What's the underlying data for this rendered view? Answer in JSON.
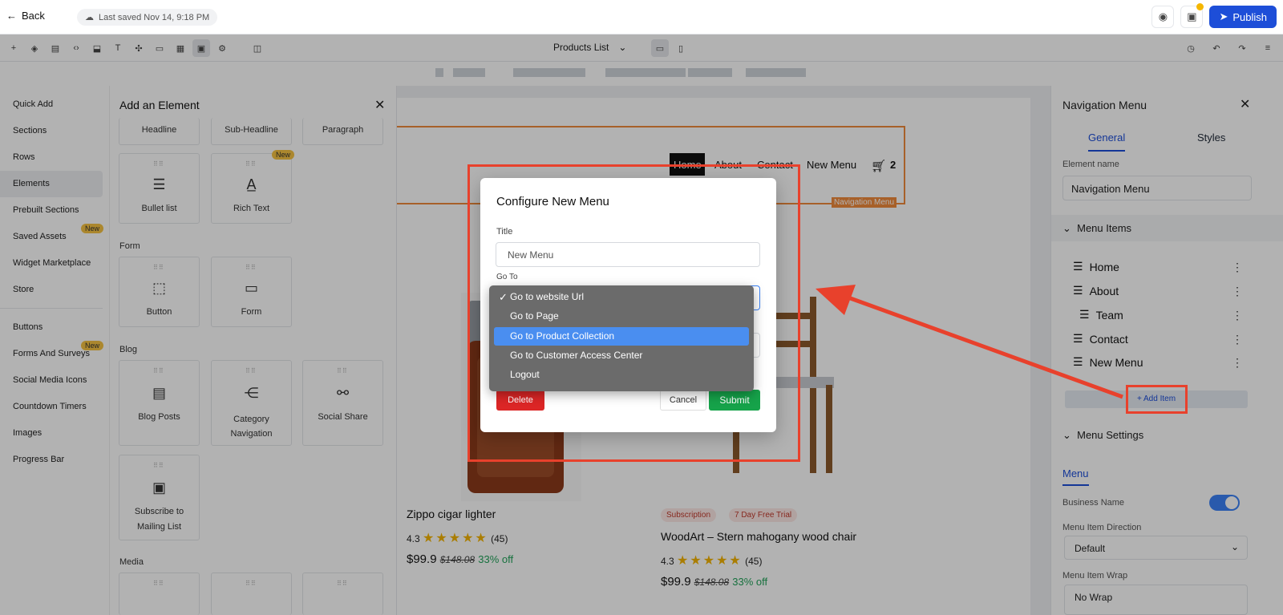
{
  "topbar": {
    "back_label": "Back",
    "saved_label": "Last saved Nov 14, 9:18 PM",
    "publish_label": "Publish"
  },
  "toolbar": {
    "page_select": "Products List"
  },
  "leftnav": {
    "items": [
      "Quick Add",
      "Sections",
      "Rows",
      "Elements",
      "Prebuilt Sections",
      "Saved Assets",
      "Widget Marketplace",
      "Store",
      "Buttons",
      "Forms And Surveys",
      "Social Media Icons",
      "Countdown Timers",
      "Images",
      "Progress Bar"
    ],
    "new_badge": "New"
  },
  "element_panel": {
    "title": "Add an Element",
    "top_cards": [
      "Headline",
      "Sub-Headline",
      "Paragraph"
    ],
    "cards_row1": [
      "Bullet list",
      "Rich Text"
    ],
    "form_label": "Form",
    "form_cards": [
      "Button",
      "Form"
    ],
    "blog_label": "Blog",
    "blog_cards": [
      "Blog Posts",
      "Category Navigation",
      "Social Share"
    ],
    "subscribe_card": "Subscribe to Mailing List",
    "media_label": "Media"
  },
  "canvas": {
    "menu": [
      "Home",
      "About",
      "Contact",
      "New Menu"
    ],
    "cart_count": "2",
    "nav_tag": "Navigation Menu",
    "products": [
      {
        "title": "Zippo cigar lighter",
        "rating": "4.3",
        "reviews": "(45)",
        "price": "$99.9",
        "old_price": "$148.08",
        "off": "33% off"
      },
      {
        "title": "WoodArt – Stern mahogany wood chair",
        "rating": "4.3",
        "reviews": "(45)",
        "price": "$99.9",
        "old_price": "$148.08",
        "off": "33% off",
        "tags": [
          "Subscription",
          "7 Day Free Trial"
        ]
      }
    ]
  },
  "modal": {
    "title": "Configure New Menu",
    "title_label": "Title",
    "title_placeholder": "New Menu",
    "goto_label": "Go To",
    "delete_label": "Delete",
    "cancel_label": "Cancel",
    "submit_label": "Submit",
    "options": [
      "Go to website Url",
      "Go to Page",
      "Go to Product Collection",
      "Go to Customer Access Center",
      "Logout"
    ],
    "selected_option": "Go to website Url",
    "highlighted_option": "Go to Product Collection"
  },
  "rightpanel": {
    "title": "Navigation Menu",
    "tabs": [
      "General",
      "Styles"
    ],
    "element_name_label": "Element name",
    "element_name_value": "Navigation Menu",
    "menu_items_label": "Menu Items",
    "menu_items": [
      "Home",
      "About",
      "Team",
      "Contact",
      "New Menu"
    ],
    "add_item_label": "Add Item",
    "menu_settings_label": "Menu Settings",
    "menu_subtab": "Menu",
    "business_name_label": "Business Name",
    "direction_label": "Menu Item Direction",
    "direction_value": "Default",
    "wrap_label": "Menu Item Wrap",
    "wrap_value": "No Wrap"
  },
  "colors": {
    "accent": "#1d4ed8",
    "annotation_red": "#e8412c",
    "nav_outline": "#f08a3c",
    "submit_green": "#16a34a",
    "delete_red": "#dc2626"
  }
}
